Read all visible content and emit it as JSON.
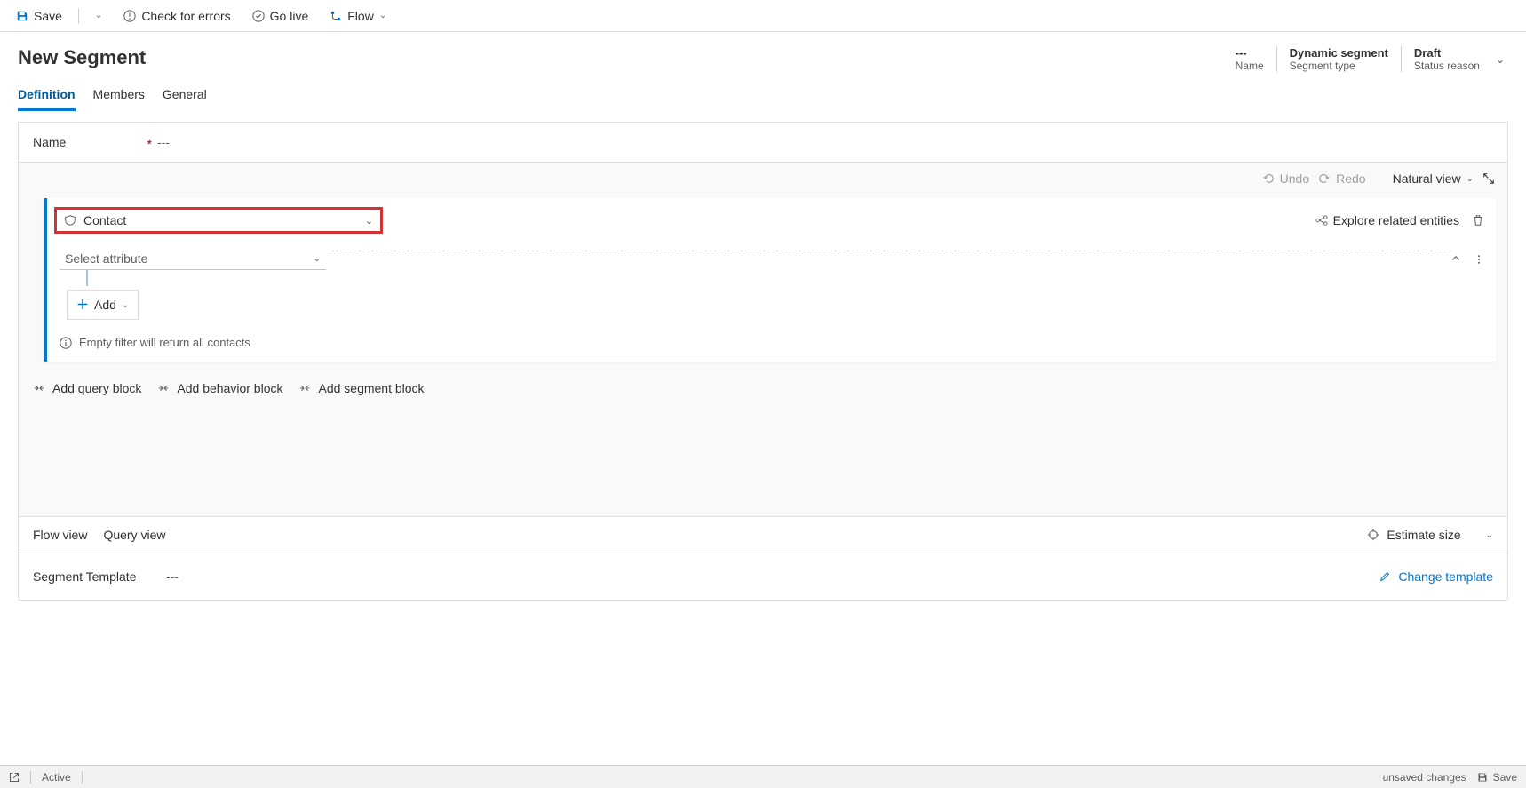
{
  "toolbar": {
    "save": "Save",
    "check_errors": "Check for errors",
    "go_live": "Go live",
    "flow": "Flow"
  },
  "page": {
    "title": "New Segment"
  },
  "meta": {
    "name": {
      "value": "---",
      "label": "Name"
    },
    "segment_type": {
      "value": "Dynamic segment",
      "label": "Segment type"
    },
    "status_reason": {
      "value": "Draft",
      "label": "Status reason"
    }
  },
  "tabs": {
    "definition": "Definition",
    "members": "Members",
    "general": "General"
  },
  "name_field": {
    "label": "Name",
    "value": "---"
  },
  "builder_toolbar": {
    "undo": "Undo",
    "redo": "Redo",
    "view_mode": "Natural view"
  },
  "query": {
    "entity": "Contact",
    "attribute_placeholder": "Select attribute",
    "add": "Add",
    "explore_related": "Explore related entities",
    "info": "Empty filter will return all contacts"
  },
  "add_blocks": {
    "query": "Add query block",
    "behavior": "Add behavior block",
    "segment": "Add segment block"
  },
  "views": {
    "flow": "Flow view",
    "query": "Query view",
    "estimate": "Estimate size"
  },
  "template": {
    "label": "Segment Template",
    "value": "---",
    "change": "Change template"
  },
  "statusbar": {
    "active": "Active",
    "unsaved": "unsaved changes",
    "save": "Save"
  }
}
